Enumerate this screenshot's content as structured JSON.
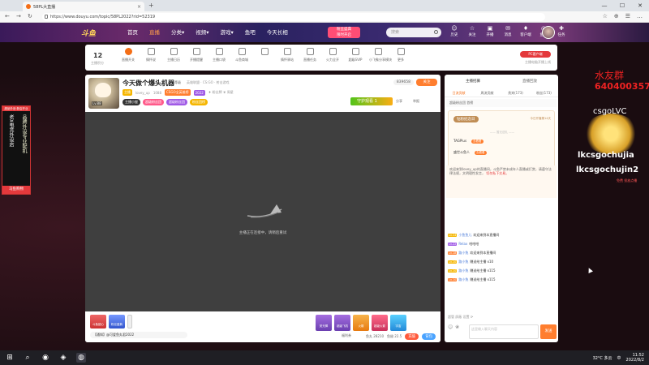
{
  "browser": {
    "tab_title": "58PL大直播",
    "tab_close": "×",
    "new_tab": "+",
    "url": "https://www.douyu.com/topic/58PL2022?rid=52319",
    "nav": {
      "back": "←",
      "forward": "→",
      "refresh": "↻"
    },
    "win": {
      "min": "—",
      "max": "☐",
      "close": "✕"
    },
    "icons": [
      "☆",
      "⊕",
      "☰",
      "…"
    ]
  },
  "header": {
    "logo": "斗鱼",
    "nav": [
      "首页",
      "直播",
      "分类▾",
      "视频▾",
      "游戏▾",
      "鱼吧",
      "今天长相"
    ],
    "active_index": 1,
    "promo_top": "粉丝盛典",
    "promo_bottom": "限时开启",
    "search_placeholder": "搜索",
    "tools": [
      {
        "glyph": "☺",
        "label": "历史"
      },
      {
        "glyph": "☆",
        "label": "关注"
      },
      {
        "glyph": "▣",
        "label": "开播"
      },
      {
        "glyph": "✉",
        "label": "消息"
      },
      {
        "glyph": "♦",
        "label": "客户端"
      },
      {
        "glyph": "◎",
        "label": "鱼秀"
      },
      {
        "glyph": "✚",
        "label": "任务"
      }
    ]
  },
  "side_banner": {
    "ribbon": "超品外设·新店开业",
    "text_left": "老X电竞外设店",
    "text_right": "品牌外设专业配机",
    "tag": "马鱼购物"
  },
  "catbar": {
    "count": "12",
    "count_label": "主播积分",
    "items": [
      "直播开关",
      "情怀说",
      "主播日历",
      "开播提醒",
      "主播口袋",
      "斗鱼商城",
      "",
      "情怀驿站",
      "直播任务",
      "火力全开",
      "超级SVIP",
      "小飞象分享模块",
      "更多"
    ],
    "anchor_btn": "PC客户端",
    "anchor_sub": "主播电脑开播上线"
  },
  "room": {
    "title": "今天做个爆头机器",
    "tag": "等级",
    "meta": "英雄联盟 · CS:GO · 射击游戏",
    "level": "Lv.88",
    "owner_badge": "主播",
    "name": "lovey_up",
    "fans": "1088",
    "badge_hot": "CSGO全英雄榜",
    "badge_year": "2022",
    "extra": "♦ 粉丝牌  ♛ 周星",
    "watch": "839658",
    "follow": "关注",
    "pills": [
      "主播小屋",
      "超级粉丝团",
      "超级粉丝团",
      "粉丝团榜"
    ],
    "contrib": "守护观看",
    "contrib_num": "1",
    "share": "分享",
    "report": "举报",
    "loading_text": "主播正在连接中，请稍后重试"
  },
  "gift_bar": {
    "left": [
      {
        "label": "斗鱼甜心",
        "style": "r"
      },
      {
        "label": "粉丝盛典",
        "style": "b"
      }
    ],
    "ticker": "【通知】@可爱鱼丸君2022",
    "gifts": [
      "荧光棒",
      "超级飞机",
      "火箭",
      "超级火箭",
      "宇宙"
    ],
    "stats": [
      "鱼丸 28210",
      "鱼翅 22.5"
    ],
    "recharge": "充值",
    "backpack": "背包",
    "gift_num": "福利券"
  },
  "right_panel": {
    "tabs": [
      "主播招募",
      "直播回放"
    ],
    "subtabs": [
      "日流贡献",
      "周流贡献",
      "贵宾(173)",
      "粉丝(173)"
    ],
    "active_subtab": 0,
    "rank_banner": "超级粉丝团 首榜",
    "memorial_title": "钻粉纪念日",
    "memorial_date": "今日开播第14天",
    "memorial_hint": "——  暂无送礼  ——",
    "memorial_rows": [
      {
        "name": "TAGPlus",
        "btn": "去看看"
      },
      {
        "name": "盛世斗鱼人",
        "btn": "去看看"
      }
    ],
    "welcome": "欢迎来到lovey_up的直播间，斗鱼严禁未成年人直播或打赏，请遵守法律法规，文明理性发言，",
    "welcome_hl": "切勿私下交易。"
  },
  "chat": [
    {
      "lv": "Lv.14",
      "lvc": "y",
      "name": "小鱼鱼儿",
      "text": "欢迎来到本直播间"
    },
    {
      "lv": "Lv.22",
      "lvc": "p",
      "name": "Relax",
      "text": "哈哈哈"
    },
    {
      "lv": "Lv.18",
      "lvc": "r",
      "name": "路小兔",
      "text": "欢迎来到本直播间"
    },
    {
      "lv": "Lv.10",
      "lvc": "y",
      "name": "路小兔",
      "text": "赠送给主播 x10"
    },
    {
      "lv": "Lv.10",
      "lvc": "y",
      "name": "路小兔",
      "text": "赠送给主播 x115"
    },
    {
      "lv": "Lv.10",
      "lvc": "r",
      "name": "路小兔",
      "text": "赠送给主播 x115"
    }
  ],
  "chat_footer": "超管    屏蔽    设置    ⟳",
  "chat_input_placeholder": "这里输入聊天内容",
  "send": "发送",
  "overlay": {
    "name": "水友群",
    "number": "640400357",
    "code": "csgoLVC",
    "id1": "lkcsgochujia",
    "id2": "lkcsgochujin2",
    "small": "免费 投放点播"
  },
  "taskbar": {
    "icons": [
      "⊞",
      "⌕",
      "◉",
      "◈",
      "◍"
    ],
    "weather": "32°C 多云",
    "ime": "中",
    "clock_time": "11:52",
    "clock_date": "2022/8/2"
  }
}
